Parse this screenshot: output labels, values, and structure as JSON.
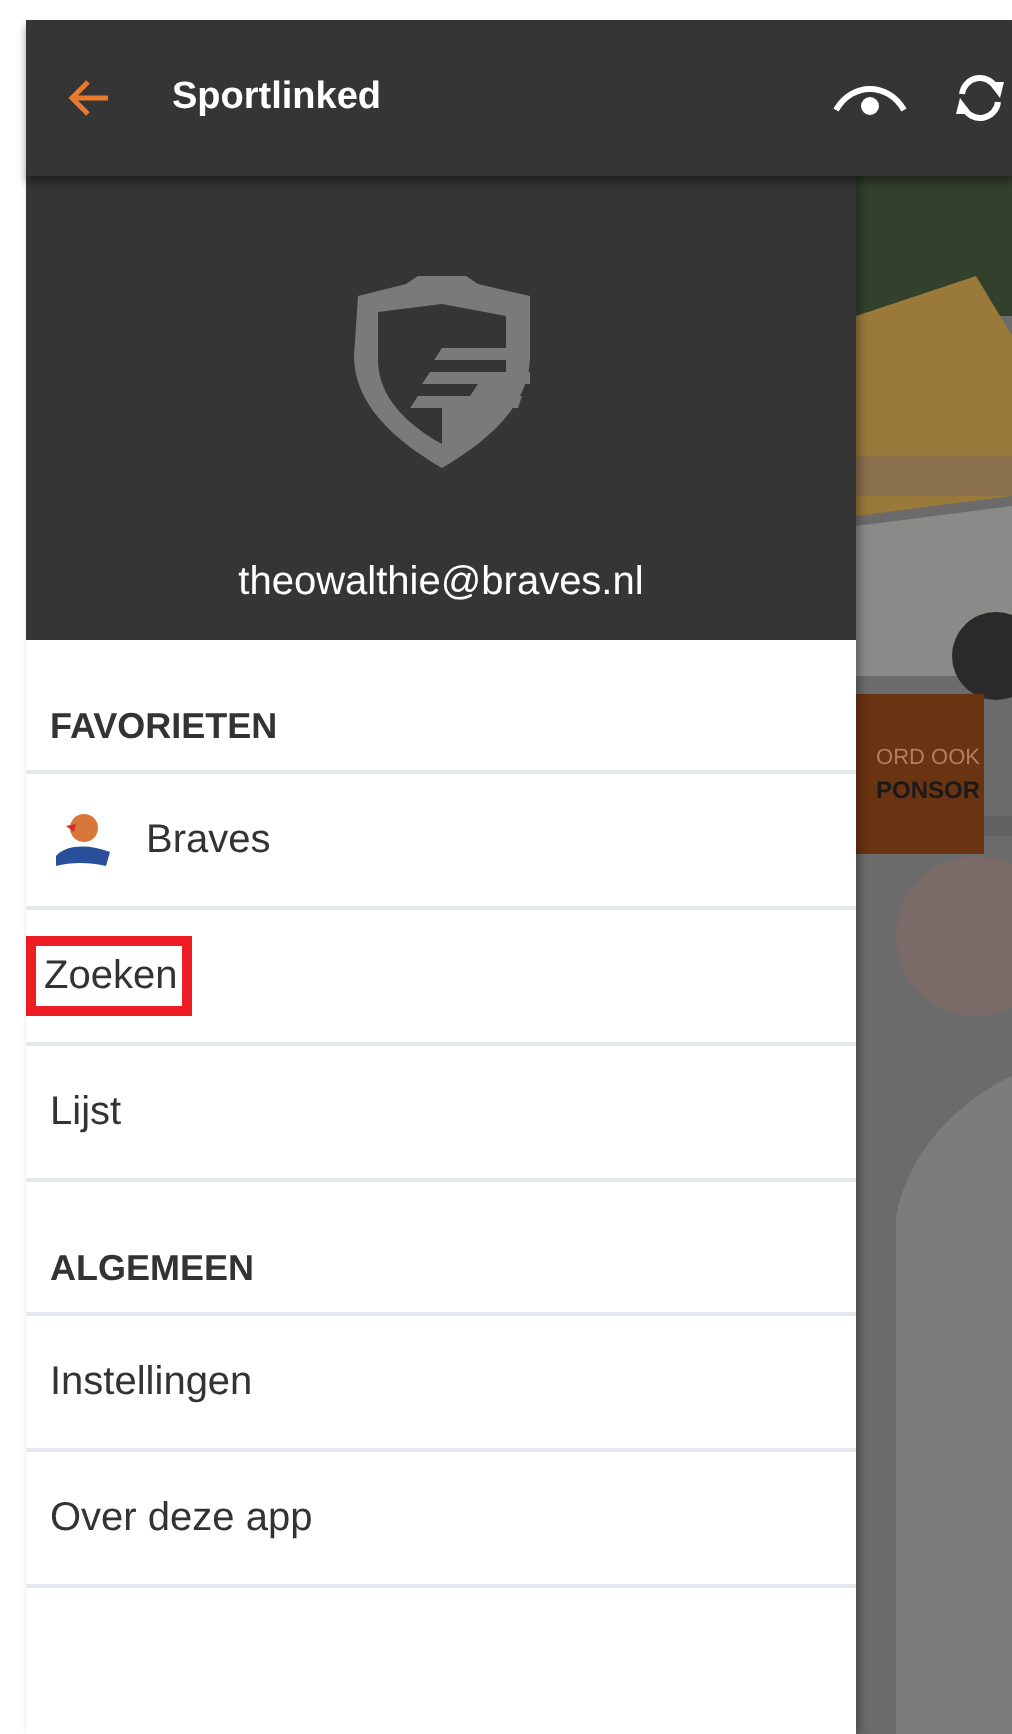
{
  "app_bar": {
    "title": "Sportlinked"
  },
  "profile": {
    "email": "theowalthie@braves.nl"
  },
  "menu": [
    {
      "kind": "header",
      "label": "FAVORIETEN"
    },
    {
      "kind": "club",
      "label": "Braves",
      "highlighted": false
    },
    {
      "kind": "item",
      "label": "Zoeken",
      "highlighted": true
    },
    {
      "kind": "item",
      "label": "Lijst",
      "highlighted": false
    },
    {
      "kind": "header",
      "label": "ALGEMEEN"
    },
    {
      "kind": "item",
      "label": "Instellingen",
      "highlighted": false
    },
    {
      "kind": "item",
      "label": "Over deze app",
      "highlighted": false
    }
  ],
  "background_banner": [
    "ORD OOK",
    "PONSOR"
  ]
}
